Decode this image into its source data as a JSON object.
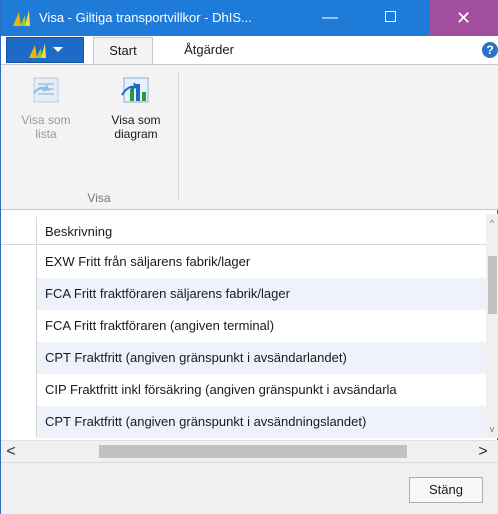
{
  "window": {
    "title": "Visa - Giltiga transportvillkor - DhIS...",
    "minimize": "—",
    "close": "✕"
  },
  "ribbon": {
    "tabs": [
      {
        "label": "Start"
      },
      {
        "label": "Åtgärder"
      }
    ],
    "help": "?",
    "buttons": {
      "show_as_list": "Visa som lista",
      "show_as_chart": "Visa som diagram"
    },
    "group_label": "Visa"
  },
  "grid": {
    "column_header": "Beskrivning",
    "rows": [
      "EXW Fritt från säljarens fabrik/lager",
      "FCA Fritt fraktföraren säljarens fabrik/lager",
      "FCA Fritt fraktföraren (angiven terminal)",
      "CPT Fraktfritt (angiven gränspunkt i avsändarlandet)",
      "CIP Fraktfritt inkl försäkring (angiven gränspunkt i avsändarla",
      "CPT Fraktfritt (angiven gränspunkt i avsändningslandet)"
    ]
  },
  "scroll": {
    "left": "<",
    "right": ">",
    "up": "^",
    "down": "v"
  },
  "footer": {
    "close_button": "Stäng"
  },
  "colors": {
    "titlebar": "#1e7bd7",
    "close_button": "#a24e9e",
    "ribbon_bg": "#f3f3f3",
    "row_alt": "#eef3fb"
  }
}
